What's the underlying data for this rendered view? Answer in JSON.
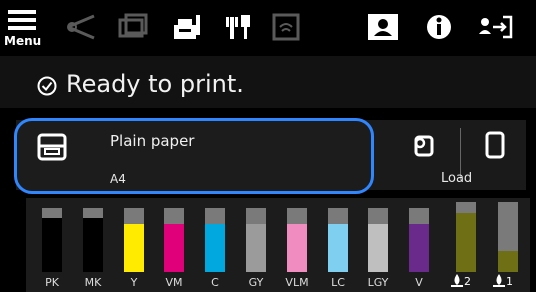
{
  "toolbar": {
    "menu_label": "Menu",
    "icons": [
      "menu-icon",
      "cutter-icon",
      "feed-icon",
      "maintenance-icon",
      "printhead-icon",
      "wifi-icon",
      "image-icon",
      "info-icon",
      "user-login-icon"
    ]
  },
  "status": {
    "text": "Ready to print.",
    "icon": "check-circle-icon"
  },
  "paper": {
    "name": "Plain paper",
    "size": "A4",
    "load_label": "Load"
  },
  "inks": [
    {
      "label": "PK",
      "color": "#000000",
      "level": 0.85
    },
    {
      "label": "MK",
      "color": "#000000",
      "level": 0.85
    },
    {
      "label": "Y",
      "color": "#ffeb00",
      "level": 0.75
    },
    {
      "label": "VM",
      "color": "#e0007a",
      "level": 0.75
    },
    {
      "label": "C",
      "color": "#00a8e0",
      "level": 0.75
    },
    {
      "label": "GY",
      "color": "#9b9b9b",
      "level": 0.75
    },
    {
      "label": "VLM",
      "color": "#f08cc0",
      "level": 0.75
    },
    {
      "label": "LC",
      "color": "#7fd0f0",
      "level": 0.75
    },
    {
      "label": "LGY",
      "color": "#bfbfbf",
      "level": 0.75
    },
    {
      "label": "V",
      "color": "#6a2a8c",
      "level": 0.75
    }
  ],
  "maintenance_tanks": [
    {
      "label": "2",
      "level": 0.85
    },
    {
      "label": "1",
      "level": 0.3
    }
  ]
}
